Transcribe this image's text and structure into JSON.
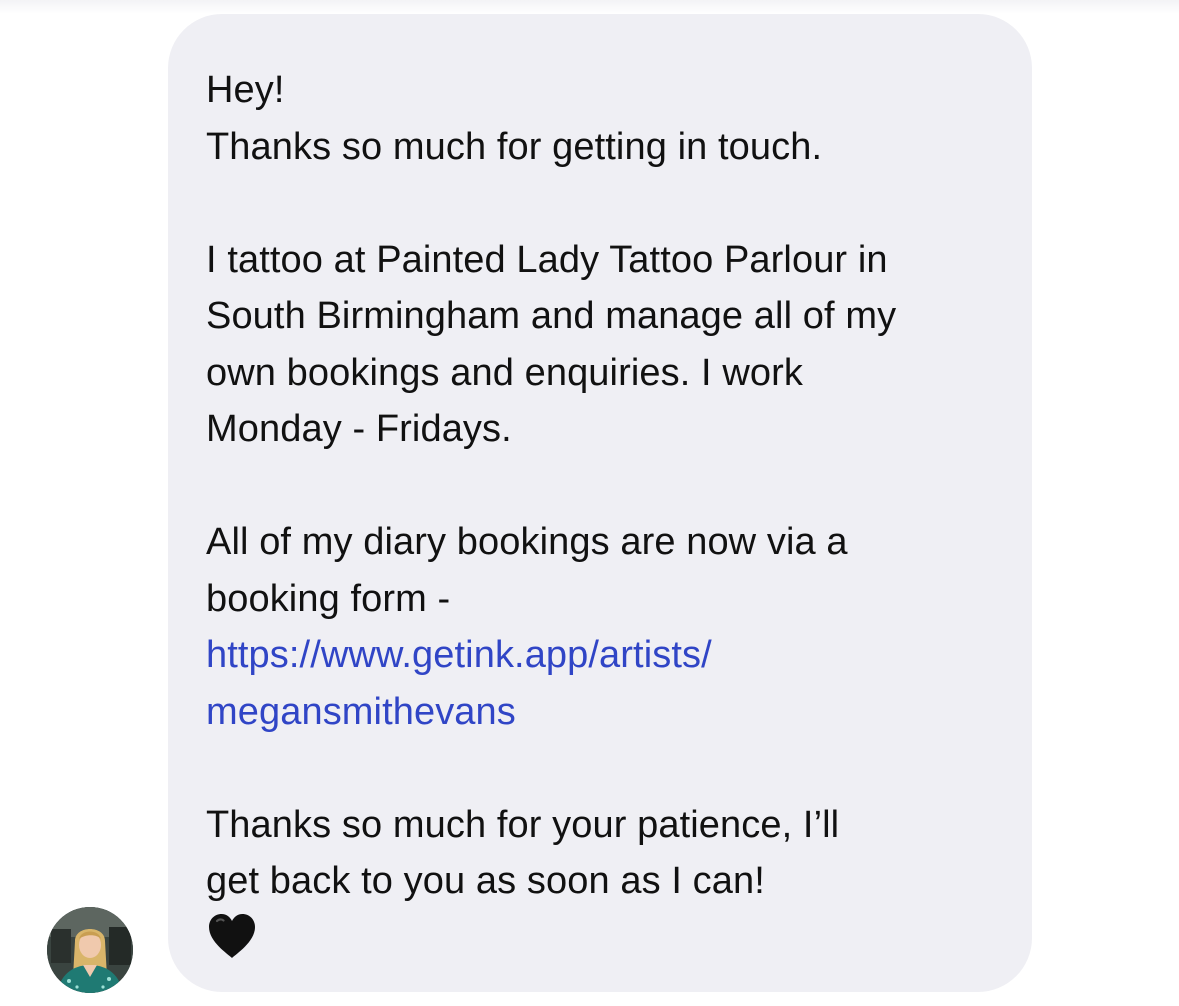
{
  "message": {
    "lines": [
      "Hey!",
      "Thanks so much for getting in touch.",
      "",
      "I tattoo at Painted Lady Tattoo Parlour in",
      "South Birmingham and manage all of my",
      "own bookings and enquiries. I work",
      "Monday - Fridays.",
      "",
      "All of my diary bookings are now via a",
      "booking form -"
    ],
    "link_line_1": "https://www.getink.app/artists/",
    "link_line_2": "megansmithevans",
    "closing_lines": [
      "Thanks so much for your patience, I’ll",
      "get back to you as soon as I can!"
    ],
    "emoji": "black-heart"
  },
  "colors": {
    "bubble": "#efeff4",
    "text": "#111111",
    "link": "#3045c6",
    "heart": "#111111"
  },
  "sender": {
    "avatar_icon": "profile-photo"
  }
}
